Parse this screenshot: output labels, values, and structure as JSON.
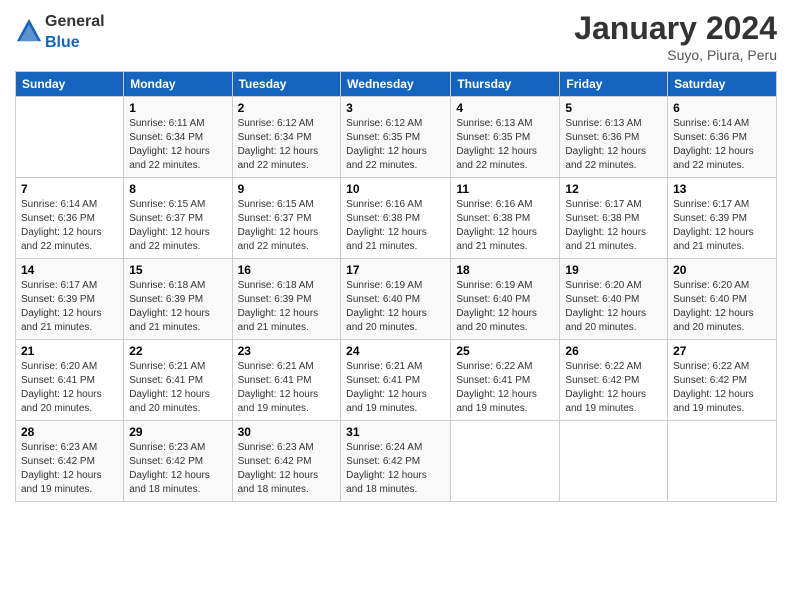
{
  "header": {
    "logo_general": "General",
    "logo_blue": "Blue",
    "title": "January 2024",
    "subtitle": "Suyo, Piura, Peru"
  },
  "days_of_week": [
    "Sunday",
    "Monday",
    "Tuesday",
    "Wednesday",
    "Thursday",
    "Friday",
    "Saturday"
  ],
  "weeks": [
    [
      {
        "day": "",
        "info": ""
      },
      {
        "day": "1",
        "info": "Sunrise: 6:11 AM\nSunset: 6:34 PM\nDaylight: 12 hours\nand 22 minutes."
      },
      {
        "day": "2",
        "info": "Sunrise: 6:12 AM\nSunset: 6:34 PM\nDaylight: 12 hours\nand 22 minutes."
      },
      {
        "day": "3",
        "info": "Sunrise: 6:12 AM\nSunset: 6:35 PM\nDaylight: 12 hours\nand 22 minutes."
      },
      {
        "day": "4",
        "info": "Sunrise: 6:13 AM\nSunset: 6:35 PM\nDaylight: 12 hours\nand 22 minutes."
      },
      {
        "day": "5",
        "info": "Sunrise: 6:13 AM\nSunset: 6:36 PM\nDaylight: 12 hours\nand 22 minutes."
      },
      {
        "day": "6",
        "info": "Sunrise: 6:14 AM\nSunset: 6:36 PM\nDaylight: 12 hours\nand 22 minutes."
      }
    ],
    [
      {
        "day": "7",
        "info": "Sunrise: 6:14 AM\nSunset: 6:36 PM\nDaylight: 12 hours\nand 22 minutes."
      },
      {
        "day": "8",
        "info": "Sunrise: 6:15 AM\nSunset: 6:37 PM\nDaylight: 12 hours\nand 22 minutes."
      },
      {
        "day": "9",
        "info": "Sunrise: 6:15 AM\nSunset: 6:37 PM\nDaylight: 12 hours\nand 22 minutes."
      },
      {
        "day": "10",
        "info": "Sunrise: 6:16 AM\nSunset: 6:38 PM\nDaylight: 12 hours\nand 21 minutes."
      },
      {
        "day": "11",
        "info": "Sunrise: 6:16 AM\nSunset: 6:38 PM\nDaylight: 12 hours\nand 21 minutes."
      },
      {
        "day": "12",
        "info": "Sunrise: 6:17 AM\nSunset: 6:38 PM\nDaylight: 12 hours\nand 21 minutes."
      },
      {
        "day": "13",
        "info": "Sunrise: 6:17 AM\nSunset: 6:39 PM\nDaylight: 12 hours\nand 21 minutes."
      }
    ],
    [
      {
        "day": "14",
        "info": "Sunrise: 6:17 AM\nSunset: 6:39 PM\nDaylight: 12 hours\nand 21 minutes."
      },
      {
        "day": "15",
        "info": "Sunrise: 6:18 AM\nSunset: 6:39 PM\nDaylight: 12 hours\nand 21 minutes."
      },
      {
        "day": "16",
        "info": "Sunrise: 6:18 AM\nSunset: 6:39 PM\nDaylight: 12 hours\nand 21 minutes."
      },
      {
        "day": "17",
        "info": "Sunrise: 6:19 AM\nSunset: 6:40 PM\nDaylight: 12 hours\nand 20 minutes."
      },
      {
        "day": "18",
        "info": "Sunrise: 6:19 AM\nSunset: 6:40 PM\nDaylight: 12 hours\nand 20 minutes."
      },
      {
        "day": "19",
        "info": "Sunrise: 6:20 AM\nSunset: 6:40 PM\nDaylight: 12 hours\nand 20 minutes."
      },
      {
        "day": "20",
        "info": "Sunrise: 6:20 AM\nSunset: 6:40 PM\nDaylight: 12 hours\nand 20 minutes."
      }
    ],
    [
      {
        "day": "21",
        "info": "Sunrise: 6:20 AM\nSunset: 6:41 PM\nDaylight: 12 hours\nand 20 minutes."
      },
      {
        "day": "22",
        "info": "Sunrise: 6:21 AM\nSunset: 6:41 PM\nDaylight: 12 hours\nand 20 minutes."
      },
      {
        "day": "23",
        "info": "Sunrise: 6:21 AM\nSunset: 6:41 PM\nDaylight: 12 hours\nand 19 minutes."
      },
      {
        "day": "24",
        "info": "Sunrise: 6:21 AM\nSunset: 6:41 PM\nDaylight: 12 hours\nand 19 minutes."
      },
      {
        "day": "25",
        "info": "Sunrise: 6:22 AM\nSunset: 6:41 PM\nDaylight: 12 hours\nand 19 minutes."
      },
      {
        "day": "26",
        "info": "Sunrise: 6:22 AM\nSunset: 6:42 PM\nDaylight: 12 hours\nand 19 minutes."
      },
      {
        "day": "27",
        "info": "Sunrise: 6:22 AM\nSunset: 6:42 PM\nDaylight: 12 hours\nand 19 minutes."
      }
    ],
    [
      {
        "day": "28",
        "info": "Sunrise: 6:23 AM\nSunset: 6:42 PM\nDaylight: 12 hours\nand 19 minutes."
      },
      {
        "day": "29",
        "info": "Sunrise: 6:23 AM\nSunset: 6:42 PM\nDaylight: 12 hours\nand 18 minutes."
      },
      {
        "day": "30",
        "info": "Sunrise: 6:23 AM\nSunset: 6:42 PM\nDaylight: 12 hours\nand 18 minutes."
      },
      {
        "day": "31",
        "info": "Sunrise: 6:24 AM\nSunset: 6:42 PM\nDaylight: 12 hours\nand 18 minutes."
      },
      {
        "day": "",
        "info": ""
      },
      {
        "day": "",
        "info": ""
      },
      {
        "day": "",
        "info": ""
      }
    ]
  ]
}
